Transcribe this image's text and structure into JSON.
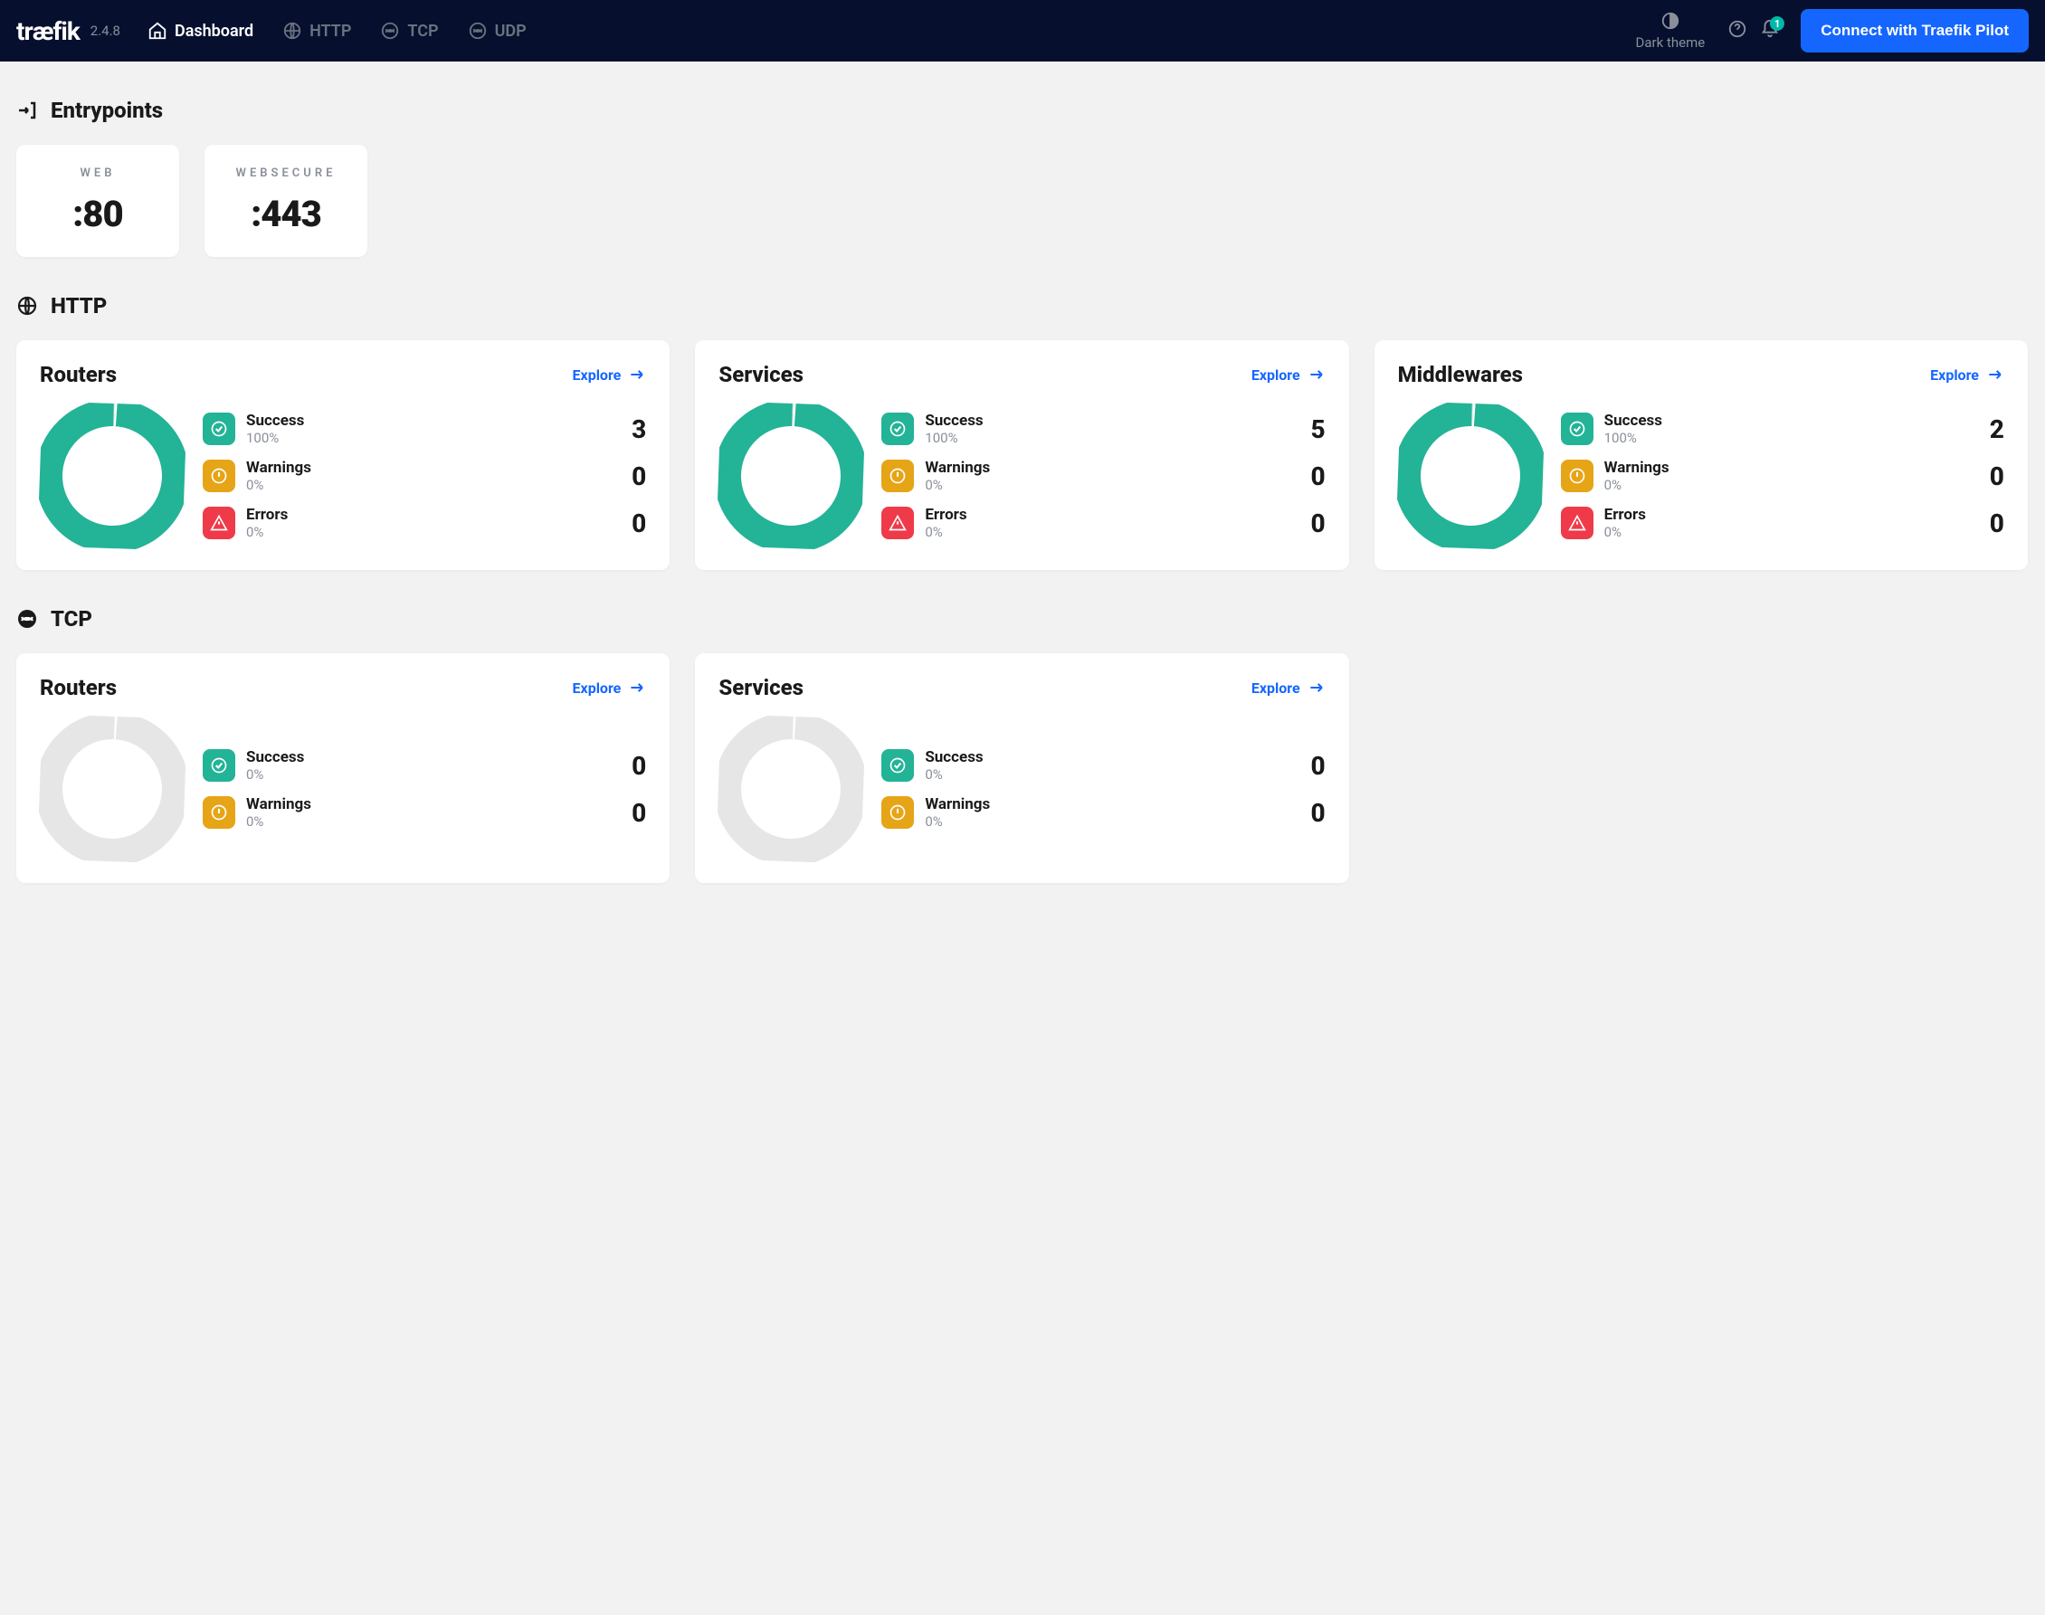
{
  "topbar": {
    "logo": "træfik",
    "version": "2.4.8",
    "nav": {
      "dashboard": "Dashboard",
      "http": "HTTP",
      "tcp": "TCP",
      "udp": "UDP"
    },
    "theme_label": "Dark theme",
    "notif_badge": "1",
    "pilot_btn": "Connect with Traefik Pilot"
  },
  "sections": {
    "entrypoints_title": "Entrypoints",
    "http_title": "HTTP",
    "tcp_title": "TCP"
  },
  "entrypoints": [
    {
      "name": "WEB",
      "port": ":80"
    },
    {
      "name": "WEBSECURE",
      "port": ":443"
    }
  ],
  "labels": {
    "explore": "Explore",
    "success": "Success",
    "warnings": "Warnings",
    "errors": "Errors"
  },
  "http": {
    "routers": {
      "title": "Routers",
      "success_pct": "100%",
      "warn_pct": "0%",
      "err_pct": "0%",
      "success_n": "3",
      "warn_n": "0",
      "err_n": "0",
      "full": true
    },
    "services": {
      "title": "Services",
      "success_pct": "100%",
      "warn_pct": "0%",
      "err_pct": "0%",
      "success_n": "5",
      "warn_n": "0",
      "err_n": "0",
      "full": true
    },
    "middlewares": {
      "title": "Middlewares",
      "success_pct": "100%",
      "warn_pct": "0%",
      "err_pct": "0%",
      "success_n": "2",
      "warn_n": "0",
      "err_n": "0",
      "full": true
    }
  },
  "tcp": {
    "routers": {
      "title": "Routers",
      "success_pct": "0%",
      "warn_pct": "0%",
      "success_n": "0",
      "warn_n": "0",
      "full": false
    },
    "services": {
      "title": "Services",
      "success_pct": "0%",
      "warn_pct": "0%",
      "success_n": "0",
      "warn_n": "0",
      "full": false
    }
  },
  "chart_data": [
    {
      "type": "pie",
      "title": "HTTP Routers",
      "categories": [
        "Success",
        "Warnings",
        "Errors"
      ],
      "values": [
        3,
        0,
        0
      ]
    },
    {
      "type": "pie",
      "title": "HTTP Services",
      "categories": [
        "Success",
        "Warnings",
        "Errors"
      ],
      "values": [
        5,
        0,
        0
      ]
    },
    {
      "type": "pie",
      "title": "HTTP Middlewares",
      "categories": [
        "Success",
        "Warnings",
        "Errors"
      ],
      "values": [
        2,
        0,
        0
      ]
    },
    {
      "type": "pie",
      "title": "TCP Routers",
      "categories": [
        "Success",
        "Warnings",
        "Errors"
      ],
      "values": [
        0,
        0,
        0
      ]
    },
    {
      "type": "pie",
      "title": "TCP Services",
      "categories": [
        "Success",
        "Warnings",
        "Errors"
      ],
      "values": [
        0,
        0,
        0
      ]
    }
  ]
}
